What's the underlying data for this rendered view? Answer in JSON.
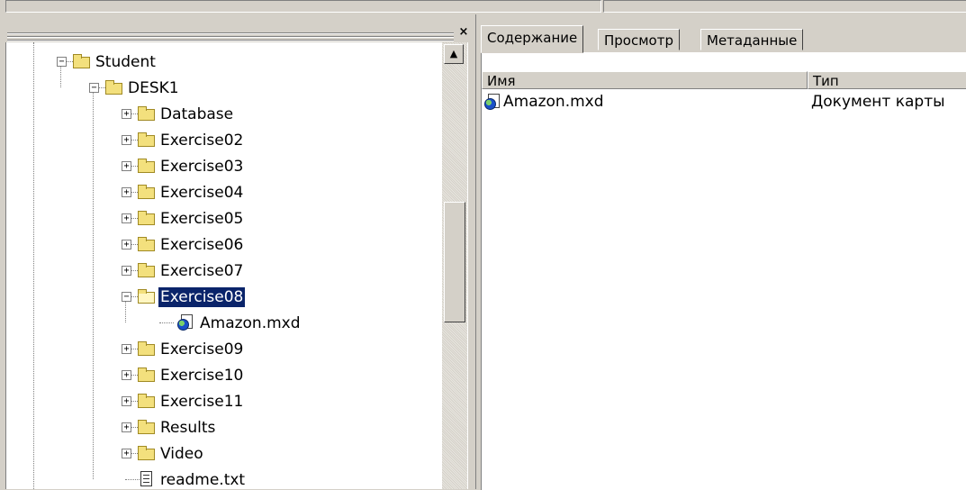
{
  "catalog_tree": {
    "nodes": [
      {
        "label": "Student",
        "icon": "folder-icon",
        "expander": "−",
        "level": 0
      },
      {
        "label": "DESK1",
        "icon": "folder-icon",
        "expander": "−",
        "level": 1
      },
      {
        "label": "Database",
        "icon": "folder-icon",
        "expander": "+",
        "level": 2
      },
      {
        "label": "Exercise02",
        "icon": "folder-icon",
        "expander": "+",
        "level": 2
      },
      {
        "label": "Exercise03",
        "icon": "folder-icon",
        "expander": "+",
        "level": 2
      },
      {
        "label": "Exercise04",
        "icon": "folder-icon",
        "expander": "+",
        "level": 2
      },
      {
        "label": "Exercise05",
        "icon": "folder-icon",
        "expander": "+",
        "level": 2
      },
      {
        "label": "Exercise06",
        "icon": "folder-icon",
        "expander": "+",
        "level": 2
      },
      {
        "label": "Exercise07",
        "icon": "folder-icon",
        "expander": "+",
        "level": 2
      },
      {
        "label": "Exercise08",
        "icon": "open-folder-icon",
        "expander": "−",
        "level": 2,
        "selected": true
      },
      {
        "label": "Amazon.mxd",
        "icon": "map-document-icon",
        "expander": "",
        "level": 3
      },
      {
        "label": "Exercise09",
        "icon": "folder-icon",
        "expander": "+",
        "level": 2
      },
      {
        "label": "Exercise10",
        "icon": "folder-icon",
        "expander": "+",
        "level": 2
      },
      {
        "label": "Exercise11",
        "icon": "folder-icon",
        "expander": "+",
        "level": 2
      },
      {
        "label": "Results",
        "icon": "folder-icon",
        "expander": "+",
        "level": 2
      },
      {
        "label": "Video",
        "icon": "folder-icon",
        "expander": "+",
        "level": 2
      },
      {
        "label": "readme.txt",
        "icon": "text-file-icon",
        "expander": "",
        "level": 2
      }
    ],
    "close_glyph": "×",
    "scroll_up_glyph": "▲"
  },
  "tabs": [
    {
      "label": "Содержание",
      "active": true
    },
    {
      "label": "Просмотр",
      "active": false
    },
    {
      "label": "Метаданные",
      "active": false
    }
  ],
  "contents": {
    "columns": [
      "Имя",
      "Тип"
    ],
    "rows": [
      {
        "name": "Amazon.mxd",
        "type": "Документ карты",
        "icon": "map-document-icon"
      }
    ]
  },
  "colors": {
    "selection": "#0a246a",
    "window_face": "#d4d0c8"
  }
}
